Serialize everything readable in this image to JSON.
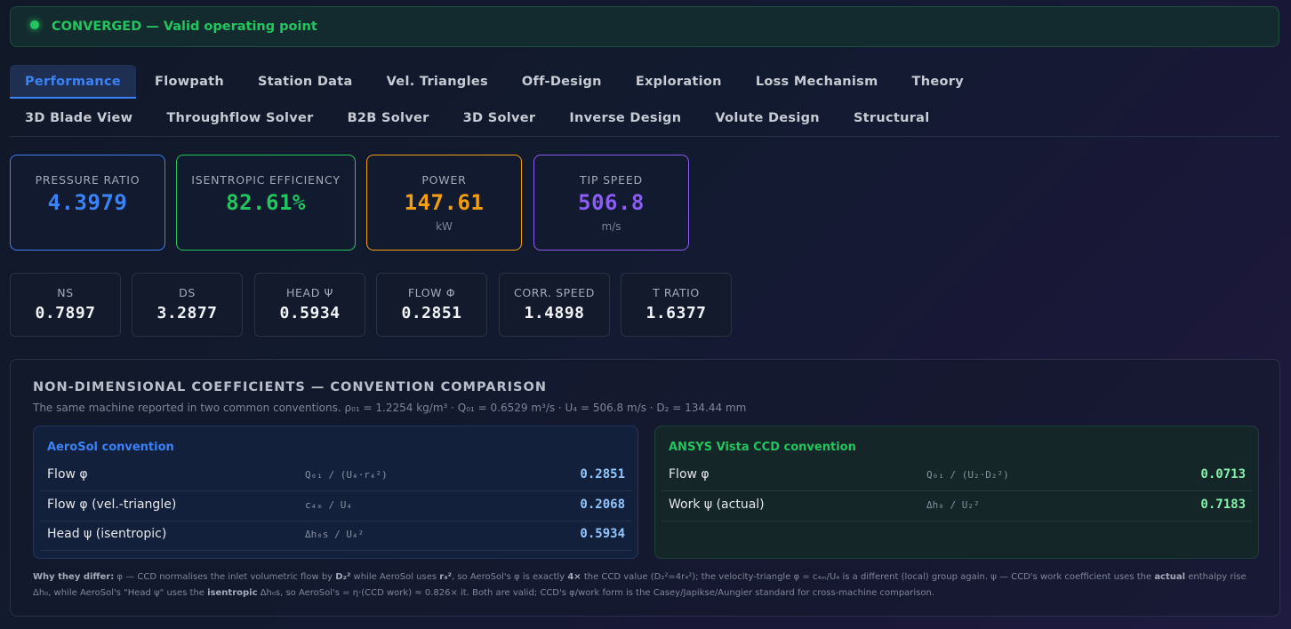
{
  "status": {
    "text": "CONVERGED — Valid operating point",
    "color": "#22c55e"
  },
  "tabs_row1": [
    "Performance",
    "Flowpath",
    "Station Data",
    "Vel. Triangles",
    "Off-Design",
    "Exploration",
    "Loss Mechanism",
    "Theory"
  ],
  "tabs_row2": [
    "3D Blade View",
    "Throughflow Solver",
    "B2B Solver",
    "3D Solver",
    "Inverse Design",
    "Volute Design",
    "Structural"
  ],
  "active_tab": "Performance",
  "kpis": [
    {
      "label": "PRESSURE RATIO",
      "value": "4.3979",
      "unit": "",
      "color": "#3b82f6"
    },
    {
      "label": "ISENTROPIC EFFICIENCY",
      "value": "82.61%",
      "unit": "",
      "color": "#22c55e"
    },
    {
      "label": "POWER",
      "value": "147.61",
      "unit": "kW",
      "color": "#f59e0b"
    },
    {
      "label": "TIP SPEED",
      "value": "506.8",
      "unit": "m/s",
      "color": "#8b5cf6"
    }
  ],
  "metrics": [
    {
      "label": "NS",
      "value": "0.7897"
    },
    {
      "label": "DS",
      "value": "3.2877"
    },
    {
      "label": "HEAD Ψ",
      "value": "0.5934"
    },
    {
      "label": "FLOW Φ",
      "value": "0.2851"
    },
    {
      "label": "CORR. SPEED",
      "value": "1.4898"
    },
    {
      "label": "T RATIO",
      "value": "1.6377"
    }
  ],
  "coefficients": {
    "title": "NON-DIMENSIONAL COEFFICIENTS — CONVENTION COMPARISON",
    "subtitle": "The same machine reported in two common conventions. ρ₀₁ = 1.2254 kg/m³ · Q₀₁ = 0.6529 m³/s · U₄ = 506.8 m/s · D₂ = 134.44 mm",
    "aerosol": {
      "heading": "AeroSol convention",
      "rows": [
        {
          "name": "Flow φ",
          "formula": "Q₀₁ / (U₄·r₄²)",
          "value": "0.2851"
        },
        {
          "name": "Flow φ (vel.-triangle)",
          "formula": "c₄ₘ / U₄",
          "value": "0.2068"
        },
        {
          "name": "Head ψ (isentropic)",
          "formula": "Δh₀s / U₄²",
          "value": "0.5934"
        }
      ]
    },
    "ansys": {
      "heading": "ANSYS Vista CCD convention",
      "rows": [
        {
          "name": "Flow φ",
          "formula": "Q₀₁ / (U₂·D₂²)",
          "value": "0.0713"
        },
        {
          "name": "Work ψ (actual)",
          "formula": "Δh₀ / U₂²",
          "value": "0.7183"
        }
      ]
    },
    "why": {
      "label": "Why they differ:",
      "p1": " φ — CCD normalises the inlet volumetric flow by ",
      "b1": "D₂²",
      "p2": " while AeroSol uses ",
      "b2": "r₄²",
      "p3": ", so AeroSol's φ is exactly ",
      "b3": "4×",
      "p4": " the CCD value (D₂²=4r₄²); the velocity-triangle φ = c₄ₘ/U₄ is a different (local) group again. ψ — CCD's work coefficient uses the ",
      "b4": "actual",
      "p5": " enthalpy rise Δh₀, while AeroSol's \"Head ψ\" uses the ",
      "b5": "isentropic",
      "p6": " Δh₀s, so AeroSol's = η·(CCD work) ≈ 0.826× it. Both are valid; CCD's φ/work form is the Casey/Japikse/Aungier standard for cross-machine comparison."
    }
  }
}
